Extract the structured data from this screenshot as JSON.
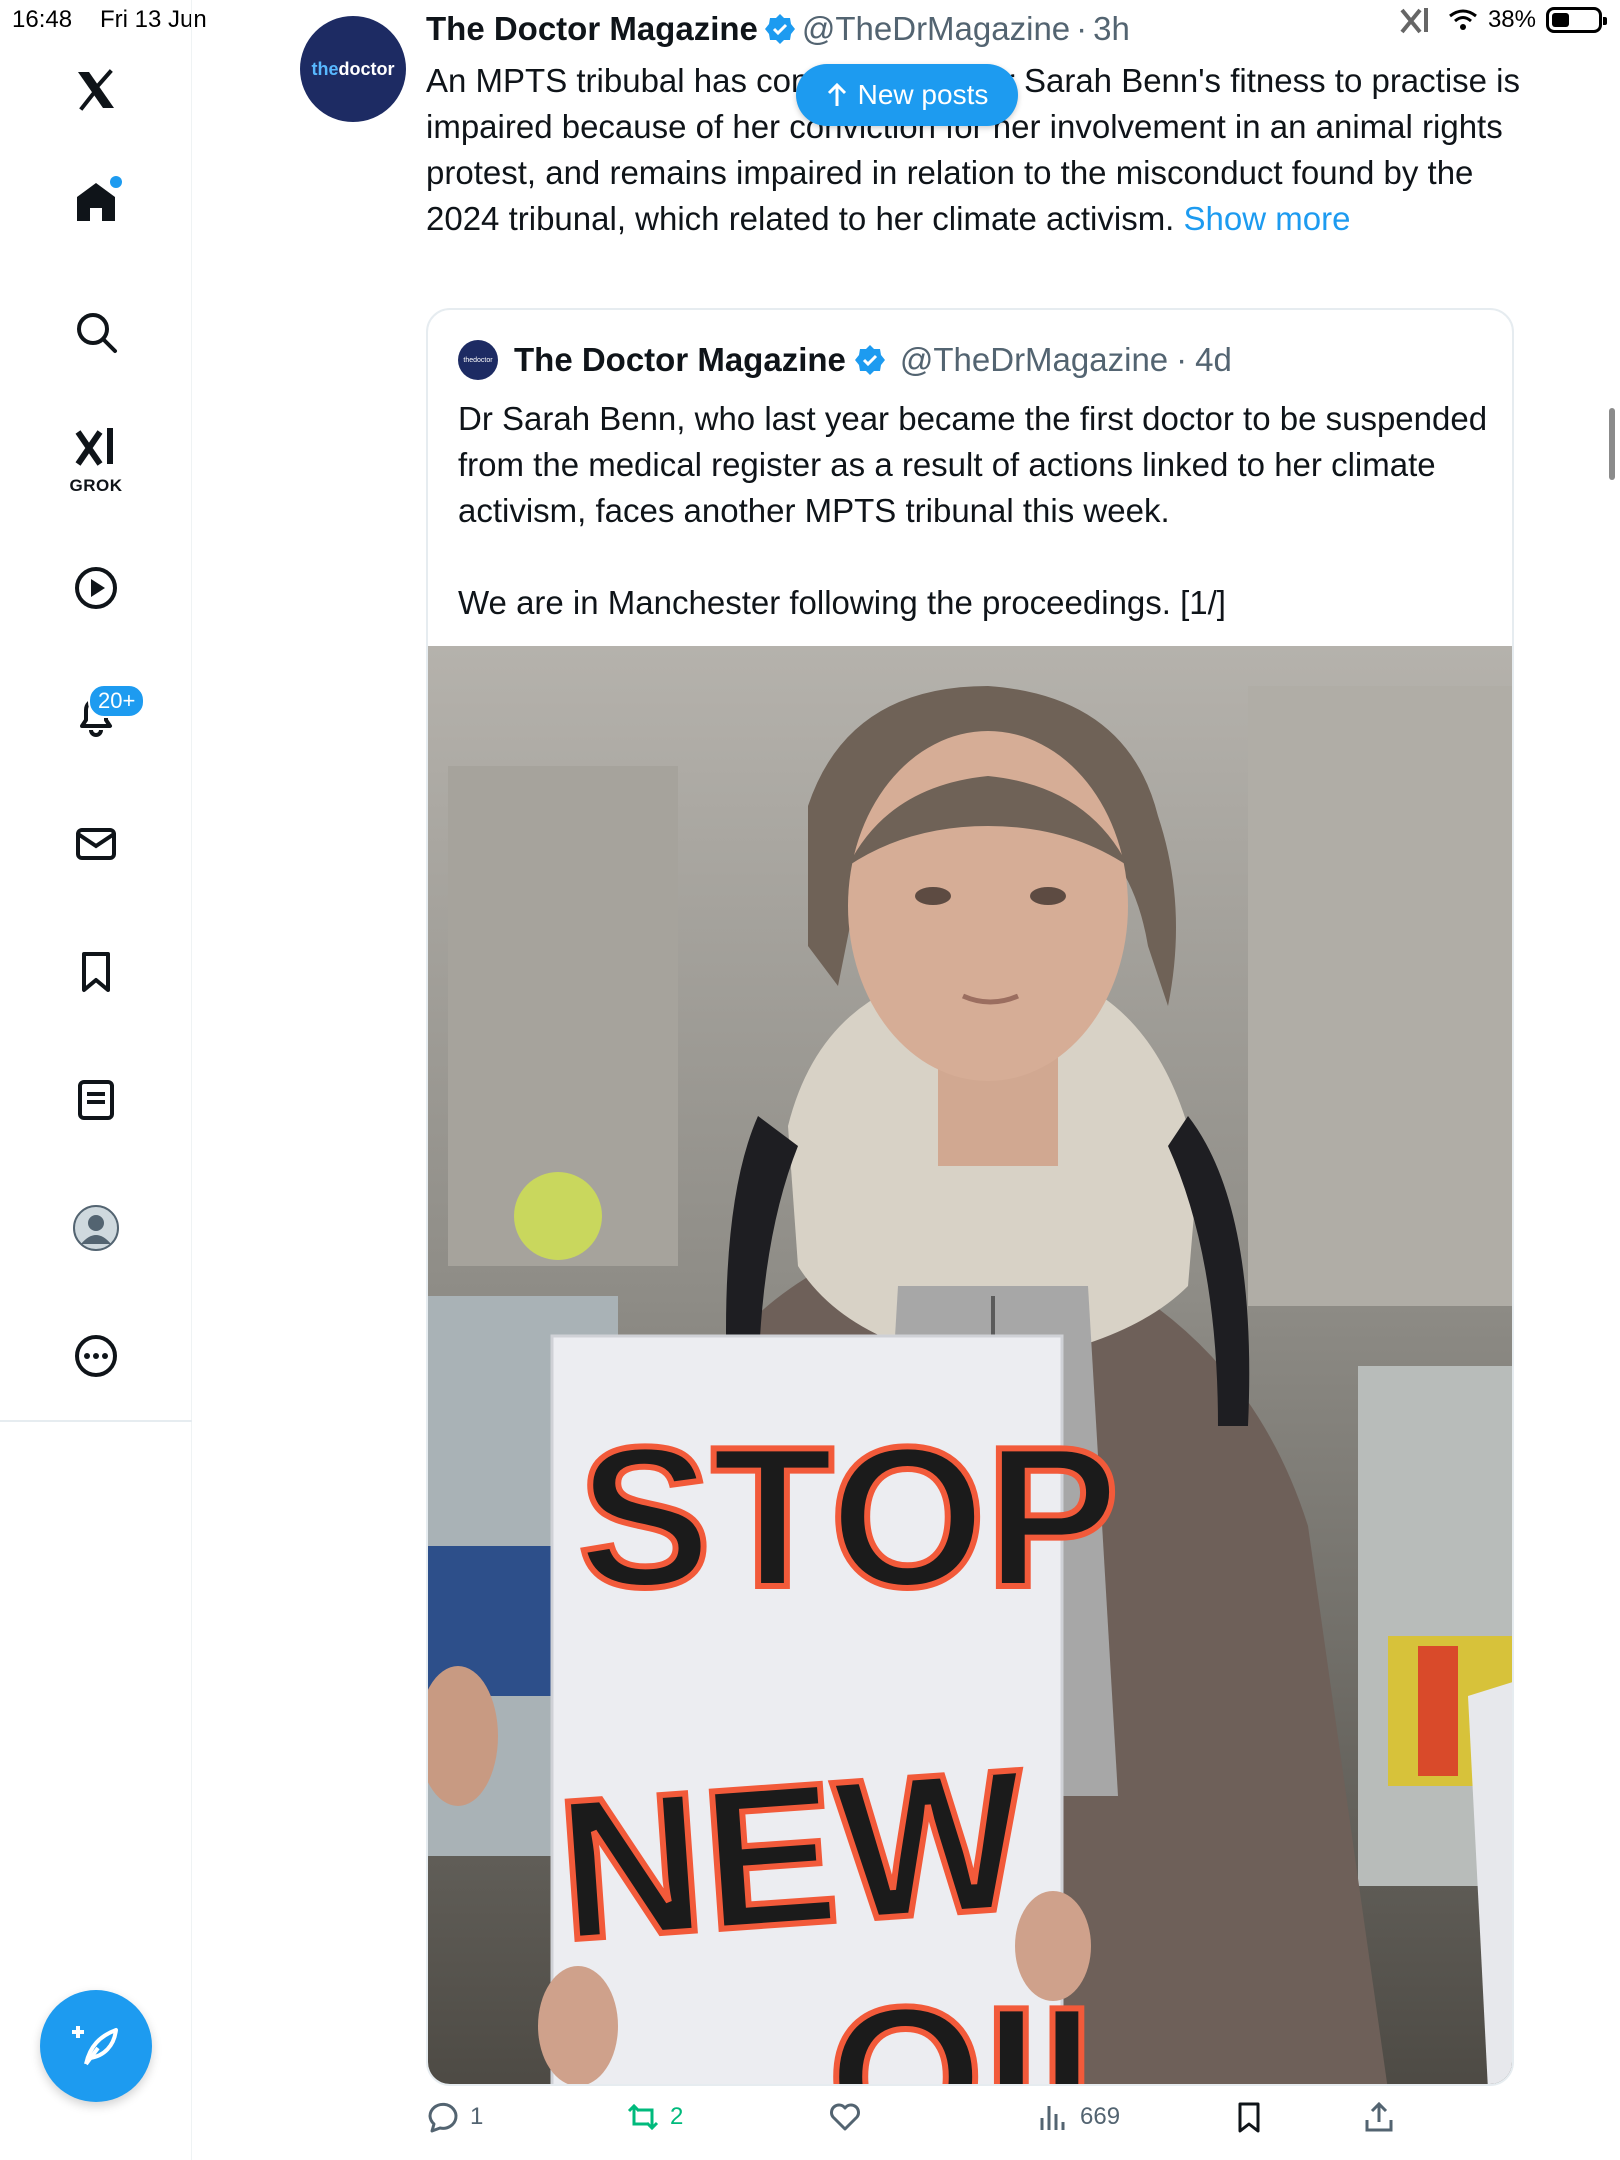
{
  "status_bar": {
    "time": "16:48",
    "date": "Fri 13 Jun",
    "battery": "38%",
    "battery_level": 0.38
  },
  "sidebar": {
    "items": [
      {
        "name": "x-logo-icon"
      },
      {
        "name": "home-icon"
      },
      {
        "name": "search-icon"
      },
      {
        "name": "grok-icon",
        "label": "GROK"
      },
      {
        "name": "video-icon"
      },
      {
        "name": "notifications-icon",
        "badge": "20+"
      },
      {
        "name": "messages-icon"
      },
      {
        "name": "bookmarks-icon"
      },
      {
        "name": "lists-icon"
      },
      {
        "name": "profile-icon"
      },
      {
        "name": "more-icon"
      }
    ],
    "accent": "#1d9bf0"
  },
  "new_posts_label": "New posts",
  "tweet": {
    "avatar_text_a": "the",
    "avatar_text_b": "doctor",
    "author": "The Doctor Magazine",
    "handle": "@TheDrMagazine",
    "separator": "·",
    "time": "3h",
    "text": "An MPTS tribubal has concluded that Dr Sarah Benn's fitness to practise is impaired because of her conviction for her involvement in an animal rights protest, and remains impaired in relation to the misconduct found by the 2024 tribunal, which related to her climate activism.",
    "show_more": "Show more",
    "actions": {
      "replies": "1",
      "reposts": "2",
      "views": "669"
    }
  },
  "quote": {
    "avatar_text": "thedoctor",
    "author": "The Doctor Magazine",
    "handle": "@TheDrMagazine",
    "separator": "·",
    "time": "4d",
    "paragraph_1": "Dr Sarah Benn, who last year became the first doctor to be suspended from the medical register as a result of actions linked to her climate activism, faces another MPTS tribunal this week.",
    "paragraph_2": "We are in Manchester following the proceedings. [1/]",
    "image": {
      "sign_line_1": "STOP",
      "sign_line_2": "NEW",
      "sign_line_3": "OIL"
    }
  },
  "colors": {
    "accent": "#1d9bf0",
    "repost_green": "#00ba7c",
    "muted": "#536471",
    "brand_navy": "#1d2b63"
  }
}
